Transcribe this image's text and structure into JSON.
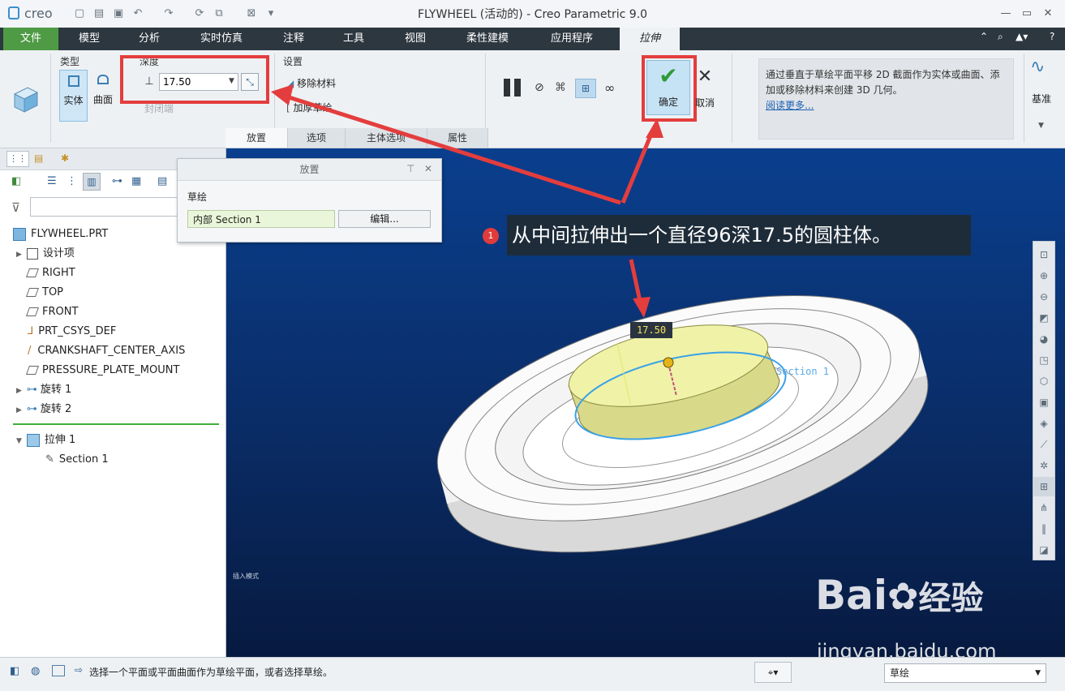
{
  "app": {
    "logo": "creo",
    "window_title": "FLYWHEEL (活动的) - Creo Parametric 9.0"
  },
  "menu_tabs": [
    "文件",
    "模型",
    "分析",
    "实时仿真",
    "注释",
    "工具",
    "视图",
    "柔性建模",
    "应用程序",
    "拉伸"
  ],
  "ribbon": {
    "type_group_label": "类型",
    "type_solid": "实体",
    "type_surface": "曲面",
    "depth_group_label": "深度",
    "depth_value": "17.50",
    "closed_ends": "封闭端",
    "settings_group_label": "设置",
    "remove_material": "移除材料",
    "thicken_sketch": "加厚草绘",
    "ok_label": "确定",
    "cancel_label": "取消",
    "datum_label": "基准",
    "help_text": "通过垂直于草绘平面平移 2D 截面作为实体或曲面、添加或移除材料来创建 3D 几何。",
    "help_link": "阅读更多...",
    "sub_tabs": [
      "放置",
      "选项",
      "主体选项",
      "属性"
    ]
  },
  "placement_panel": {
    "title": "放置",
    "sketch_label": "草绘",
    "section_value": "内部 Section 1",
    "edit_button": "编辑..."
  },
  "model_tree": {
    "root": "FLYWHEEL.PRT",
    "items": [
      "设计项",
      "RIGHT",
      "TOP",
      "FRONT",
      "PRT_CSYS_DEF",
      "CRANKSHAFT_CENTER_AXIS",
      "PRESSURE_PLATE_MOUNT",
      "旋转 1",
      "旋转 2"
    ],
    "insert_feature": "拉伸 1",
    "insert_child": "Section 1"
  },
  "viewport": {
    "callout_number": "1",
    "callout_text": "从中间拉伸出一个直径96深17.5的圆柱体。",
    "dimension_label": "17.50",
    "section_label": "Section 1",
    "insert_mode": "插入模式"
  },
  "status": {
    "message": "选择一个平面或平面曲面作为草绘平面，或者选择草绘。",
    "filter_value": "草绘"
  },
  "watermark": {
    "brand": "Bai",
    "brand_suffix": "经验",
    "url": "jingyan.baidu.com"
  },
  "colors": {
    "file_tab": "#4f9b45",
    "menubar": "#2d3740",
    "annotation_red": "#e43d3d",
    "viewport_blue": "#0a3f8e",
    "cylinder_yellow": "#f0f2a8"
  }
}
